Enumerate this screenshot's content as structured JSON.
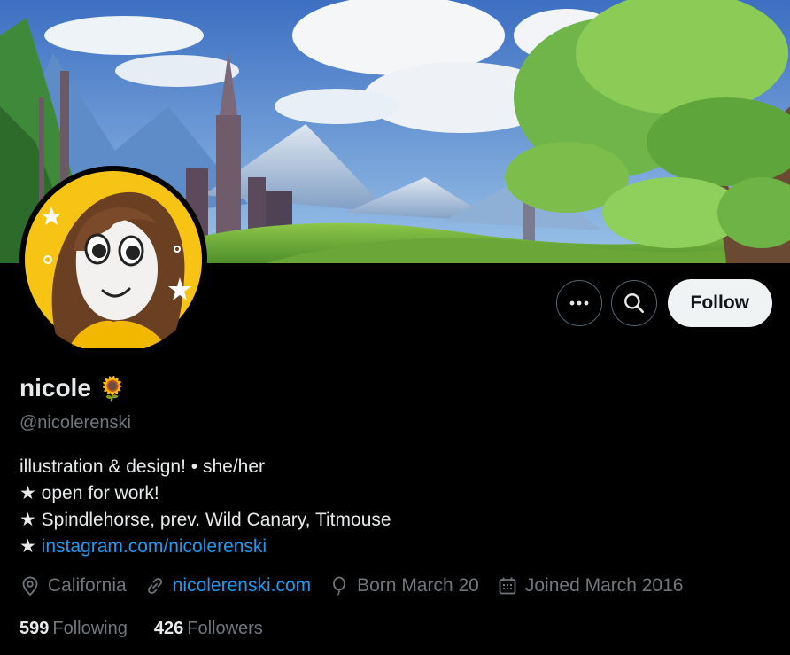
{
  "profile": {
    "display_name": "nicole",
    "name_emoji": "🌻",
    "handle": "@nicolerenski",
    "bio": [
      "illustration & design! • she/her",
      "★ open for work!",
      "★ Spindlehorse, prev. Wild Canary, Titmouse"
    ],
    "bio_link_prefix": "★ ",
    "bio_link": "instagram.com/nicolerenski",
    "location": "California",
    "website": "nicolerenski.com",
    "birthday": "Born March 20",
    "joined": "Joined March 2016",
    "following_count": "599",
    "following_label": "Following",
    "followers_count": "426",
    "followers_label": "Followers"
  },
  "actions": {
    "more_icon": "more-icon",
    "search_icon": "search-icon",
    "follow_label": "Follow"
  },
  "colors": {
    "background": "#000000",
    "text_primary": "#e7e9ea",
    "text_secondary": "#71767b",
    "link": "#1d9bf0",
    "follow_button_bg": "#eff3f4",
    "avatar_bg": "#f7c416"
  }
}
